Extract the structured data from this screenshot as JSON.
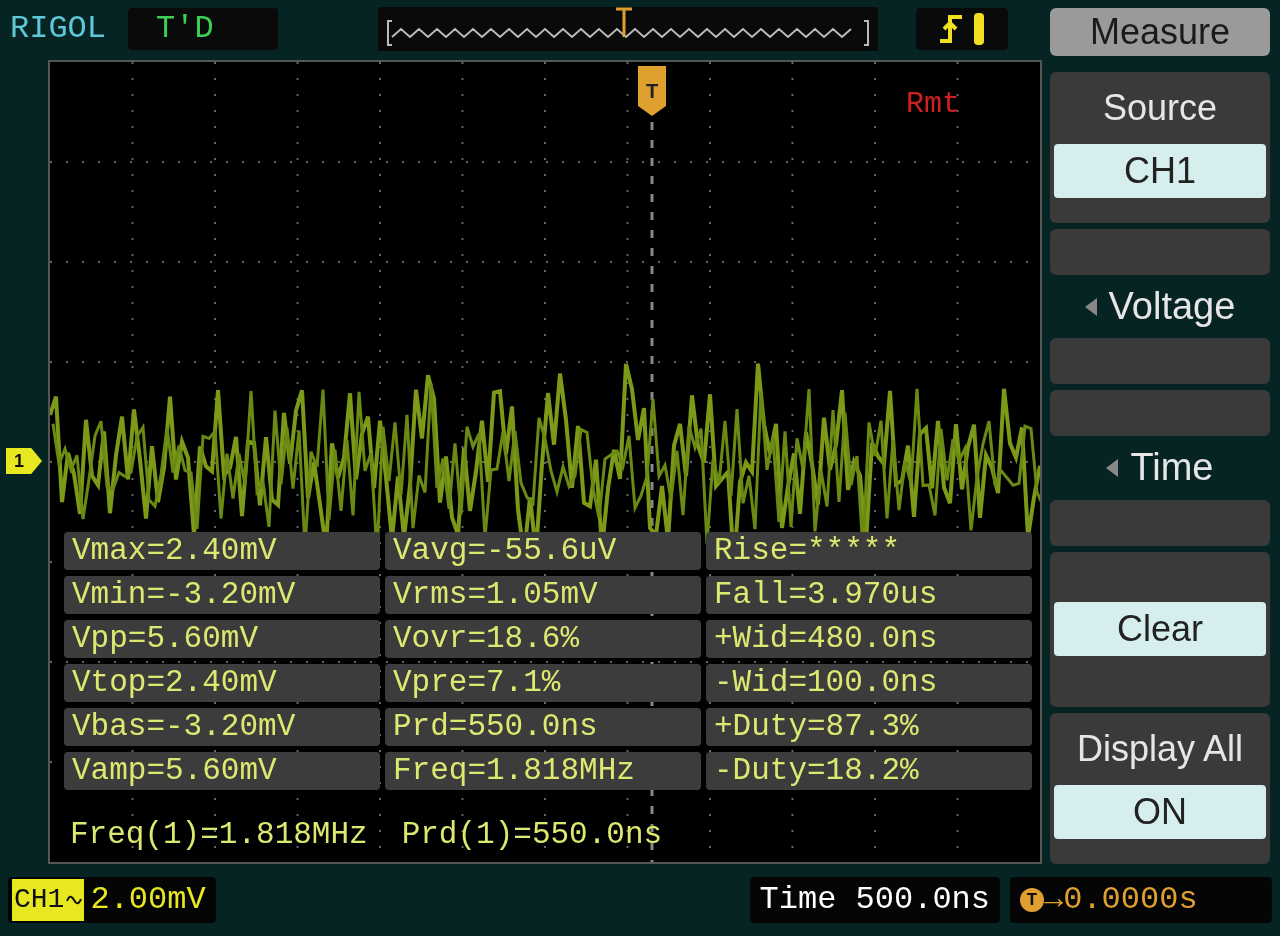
{
  "brand": "RIGOL",
  "trigger_status": "T'D",
  "remote": "Rmt",
  "trigger_marker": "T",
  "channel_marker": "1",
  "menu": [
    {
      "kind": "title",
      "label": "Measure"
    },
    {
      "kind": "option",
      "label": "Source",
      "value": "CH1"
    },
    {
      "kind": "submenu",
      "label": "Voltage"
    },
    {
      "kind": "submenu",
      "label": "Time"
    },
    {
      "kind": "button",
      "label": "Clear"
    },
    {
      "kind": "option",
      "label": "Display All",
      "value": "ON"
    }
  ],
  "measurements": [
    [
      "Vmax=2.40mV",
      "Vavg=-55.6uV",
      "Rise=*****"
    ],
    [
      "Vmin=-3.20mV",
      "Vrms=1.05mV",
      "Fall=3.970us"
    ],
    [
      "Vpp=5.60mV",
      "Vovr=18.6%",
      "+Wid=480.0ns"
    ],
    [
      "Vtop=2.40mV",
      "Vpre=7.1%",
      "-Wid=100.0ns"
    ],
    [
      "Vbas=-3.20mV",
      "Prd=550.0ns",
      "+Duty=87.3%"
    ],
    [
      "Vamp=5.60mV",
      "Freq=1.818MHz",
      "-Duty=18.2%"
    ]
  ],
  "readouts": [
    "Freq(1)=1.818MHz",
    "Prd(1)=550.0ns"
  ],
  "status_bar": {
    "channel": "CH1",
    "volts_per_div": "2.00mV",
    "timebase": "Time 500.0ns",
    "trigger_label": "T",
    "trigger_offset": "→0.0000s"
  }
}
